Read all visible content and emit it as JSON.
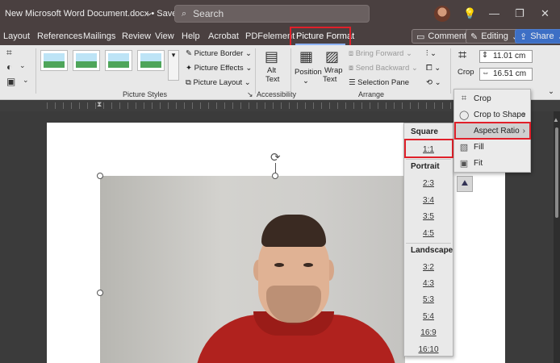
{
  "titlebar": {
    "doc_title": "New Microsoft Word Document.docx • Saved",
    "search_placeholder": "Search"
  },
  "tabs": [
    "Layout",
    "References",
    "Mailings",
    "Review",
    "View",
    "Help",
    "Acrobat",
    "PDFelement",
    "Picture Format"
  ],
  "active_tab": "Picture Format",
  "right_buttons": {
    "comments": "Comments",
    "editing": "Editing",
    "share": "Share"
  },
  "ribbon": {
    "picture_border": "Picture Border",
    "picture_effects": "Picture Effects",
    "picture_layout": "Picture Layout",
    "picture_styles_label": "Picture Styles",
    "alt_text_1": "Alt",
    "alt_text_2": "Text",
    "accessibility_label": "Accessibility",
    "position": "Position",
    "wrap_text_1": "Wrap",
    "wrap_text_2": "Text",
    "bring_forward": "Bring Forward",
    "send_backward": "Send Backward",
    "selection_pane": "Selection Pane",
    "arrange_label": "Arrange",
    "crop": "Crop",
    "height": "11.01 cm",
    "width": "16.51 cm"
  },
  "crop_menu": {
    "items": [
      "Crop",
      "Crop to Shape",
      "Aspect Ratio",
      "Fill",
      "Fit"
    ],
    "highlighted": "Aspect Ratio"
  },
  "aspect_menu": {
    "square_head": "Square",
    "square": [
      "1:1"
    ],
    "portrait_head": "Portrait",
    "portrait": [
      "2:3",
      "3:4",
      "3:5",
      "4:5"
    ],
    "landscape_head": "Landscape",
    "landscape": [
      "3:2",
      "4:3",
      "5:3",
      "5:4",
      "16:9",
      "16:10"
    ],
    "selected": "1:1"
  },
  "colors": {
    "highlight_box": "#e0202a",
    "share_button": "#3d6fc5",
    "titlebar": "#4a4040"
  }
}
